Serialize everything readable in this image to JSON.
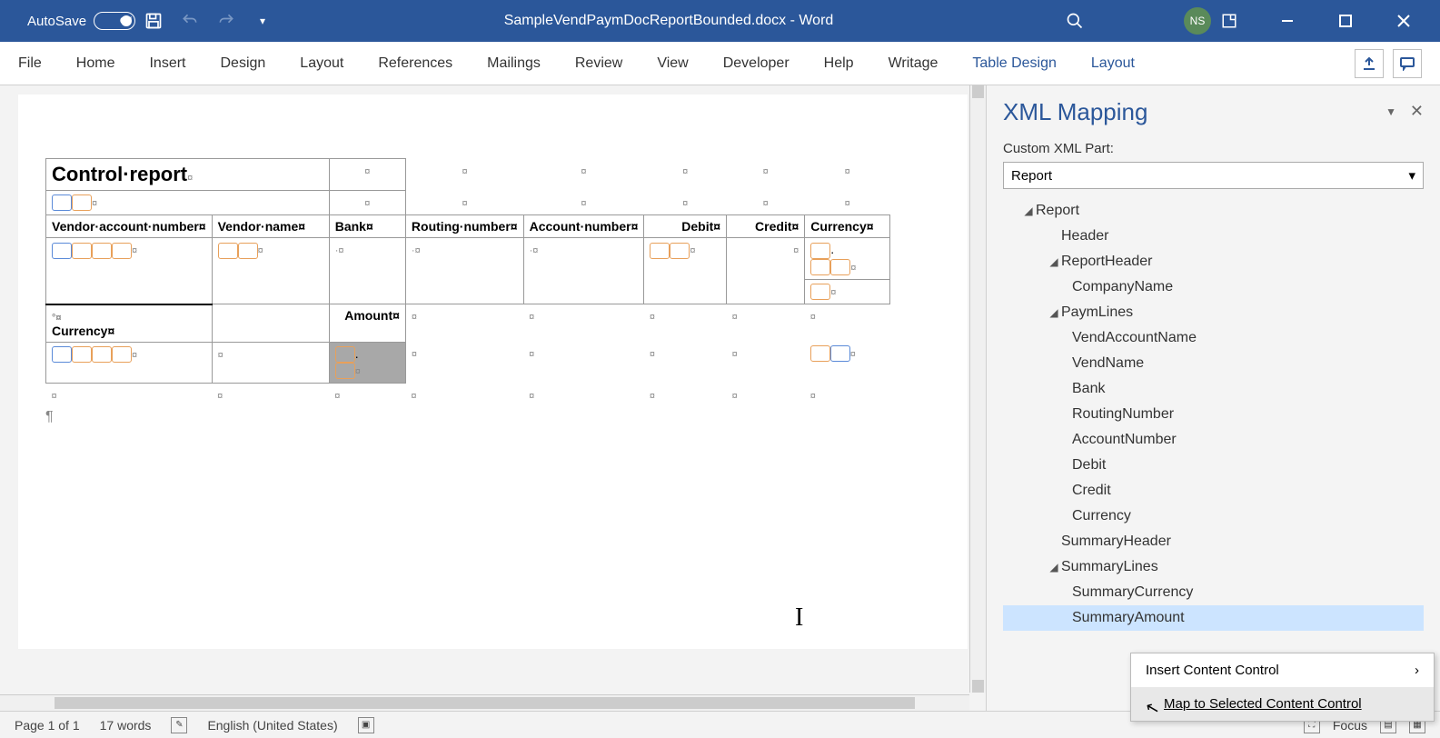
{
  "titlebar": {
    "autosave_label": "AutoSave",
    "autosave_state": "Off",
    "document_title": "SampleVendPaymDocReportBounded.docx - Word",
    "avatar_initials": "NS"
  },
  "ribbon": {
    "tabs": [
      "File",
      "Home",
      "Insert",
      "Design",
      "Layout",
      "References",
      "Mailings",
      "Review",
      "View",
      "Developer",
      "Help",
      "Writage",
      "Table Design",
      "Layout"
    ]
  },
  "document": {
    "title": "Control·report",
    "columns": {
      "vendor_account": "Vendor·account·number¤",
      "vendor_name": "Vendor·name¤",
      "bank": "Bank¤",
      "routing": "Routing·number¤",
      "account": "Account·number¤",
      "debit": "Debit¤",
      "credit": "Credit¤",
      "currency": "Currency¤"
    },
    "summary": {
      "currency": "Currency¤",
      "amount": "Amount¤"
    }
  },
  "xml_pane": {
    "title": "XML Mapping",
    "part_label": "Custom XML Part:",
    "selected_part": "Report",
    "tree": {
      "root": "Report",
      "header": "Header",
      "report_header": "ReportHeader",
      "company_name": "CompanyName",
      "paym_lines": "PaymLines",
      "vend_account": "VendAccountName",
      "vend_name": "VendName",
      "bank": "Bank",
      "routing": "RoutingNumber",
      "account": "AccountNumber",
      "debit": "Debit",
      "credit": "Credit",
      "currency": "Currency",
      "summary_header": "SummaryHeader",
      "summary_lines": "SummaryLines",
      "summary_currency": "SummaryCurrency",
      "summary_amount": "SummaryAmount"
    },
    "context_menu": {
      "insert": "Insert Content Control",
      "map": "Map to Selected Content Control"
    }
  },
  "statusbar": {
    "page": "Page 1 of 1",
    "words": "17 words",
    "language": "English (United States)",
    "focus": "Focus"
  }
}
